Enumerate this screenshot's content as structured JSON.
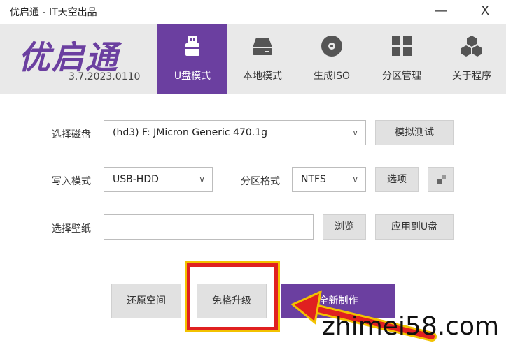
{
  "titlebar": {
    "title": "优启通 - IT天空出品",
    "minimize": "—",
    "close": "X"
  },
  "header": {
    "logo_text": "优启通",
    "version": "3.7.2023.0110",
    "tabs": [
      {
        "label": "U盘模式",
        "icon": "usb-drive-icon",
        "active": true
      },
      {
        "label": "本地模式",
        "icon": "hard-drive-icon",
        "active": false
      },
      {
        "label": "生成ISO",
        "icon": "disc-icon",
        "active": false
      },
      {
        "label": "分区管理",
        "icon": "grid-icon",
        "active": false
      },
      {
        "label": "关于程序",
        "icon": "hexagons-icon",
        "active": false
      }
    ]
  },
  "form": {
    "disk_label": "选择磁盘",
    "disk_value": "(hd3) F: JMicron Generic 470.1g",
    "simulate_button": "模拟测试",
    "write_mode_label": "写入模式",
    "write_mode_value": "USB-HDD",
    "partition_format_label": "分区格式",
    "partition_format_value": "NTFS",
    "options_button": "选项",
    "wallpaper_label": "选择壁纸",
    "wallpaper_value": "",
    "browse_button": "浏览",
    "apply_button": "应用到U盘"
  },
  "actions": {
    "restore_button": "还原空间",
    "upgrade_button": "免格升级",
    "create_button": "全新制作"
  },
  "watermark": "zhimei58.com",
  "colors": {
    "accent": "#6b3fa0",
    "highlight_red": "#e02020",
    "highlight_yellow": "#f2c200"
  }
}
